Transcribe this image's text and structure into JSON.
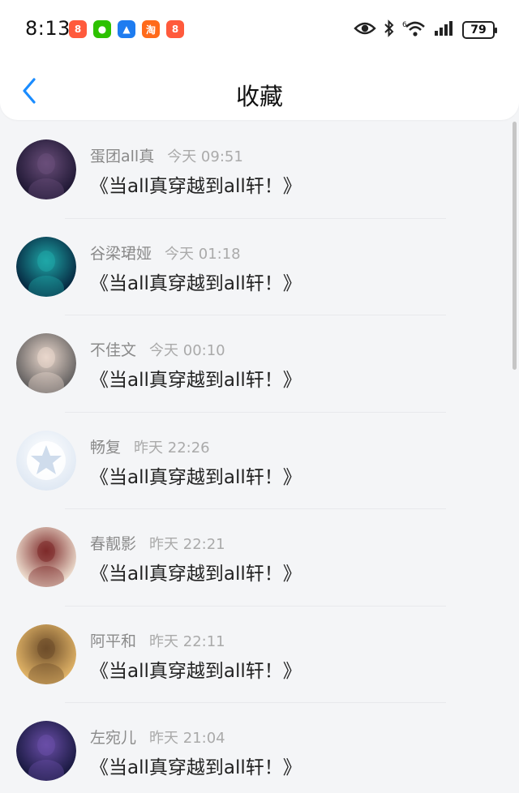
{
  "status_bar": {
    "time": "8:13",
    "app_icons": [
      {
        "name": "xiaohongshu-icon",
        "color": "#ff5a3c",
        "glyph": "8"
      },
      {
        "name": "wechat-icon",
        "color": "#2dc100",
        "glyph": "●"
      },
      {
        "name": "feishu-icon",
        "color": "#1e7cf0",
        "glyph": "▲"
      },
      {
        "name": "taobao-icon",
        "color": "#ff6a1a",
        "glyph": "淘"
      },
      {
        "name": "xiaohongshu-icon-2",
        "color": "#ff5a3c",
        "glyph": "8"
      }
    ],
    "battery": "79"
  },
  "header": {
    "title": "收藏"
  },
  "items": [
    {
      "name": "蛋团all真",
      "time": "今天 09:51",
      "message": "《当all真穿越到all轩！》",
      "avatar_colors": [
        "#1b1530",
        "#6a4e7a"
      ]
    },
    {
      "name": "谷梁珺娅",
      "time": "今天 01:18",
      "message": "《当all真穿越到all轩！》",
      "avatar_colors": [
        "#05203a",
        "#1fa7a8"
      ]
    },
    {
      "name": "不佳文",
      "time": "今天 00:10",
      "message": "《当all真穿越到all轩！》",
      "avatar_colors": [
        "#5c5a5a",
        "#e9d7cc"
      ]
    },
    {
      "name": "畅复",
      "time": "昨天 22:26",
      "message": "《当all真穿越到all轩！》",
      "avatar_colors": [
        "#dfe8f3",
        "#ffffff"
      ]
    },
    {
      "name": "春靓影",
      "time": "昨天 22:21",
      "message": "《当all真穿越到all轩！》",
      "avatar_colors": [
        "#f3e7d7",
        "#7d2a2a"
      ]
    },
    {
      "name": "阿平和",
      "time": "昨天 22:11",
      "message": "《当all真穿越到all轩！》",
      "avatar_colors": [
        "#e7b96a",
        "#6d4d2a"
      ]
    },
    {
      "name": "左宛儿",
      "time": "昨天 21:04",
      "message": "《当all真穿越到all轩！》",
      "avatar_colors": [
        "#14163a",
        "#6a4ea8"
      ]
    }
  ],
  "colors": {
    "accent": "#1a8cff",
    "divider": "#e8e9ec",
    "meta_text": "#8a8a8a",
    "background": "#f4f5f7"
  }
}
